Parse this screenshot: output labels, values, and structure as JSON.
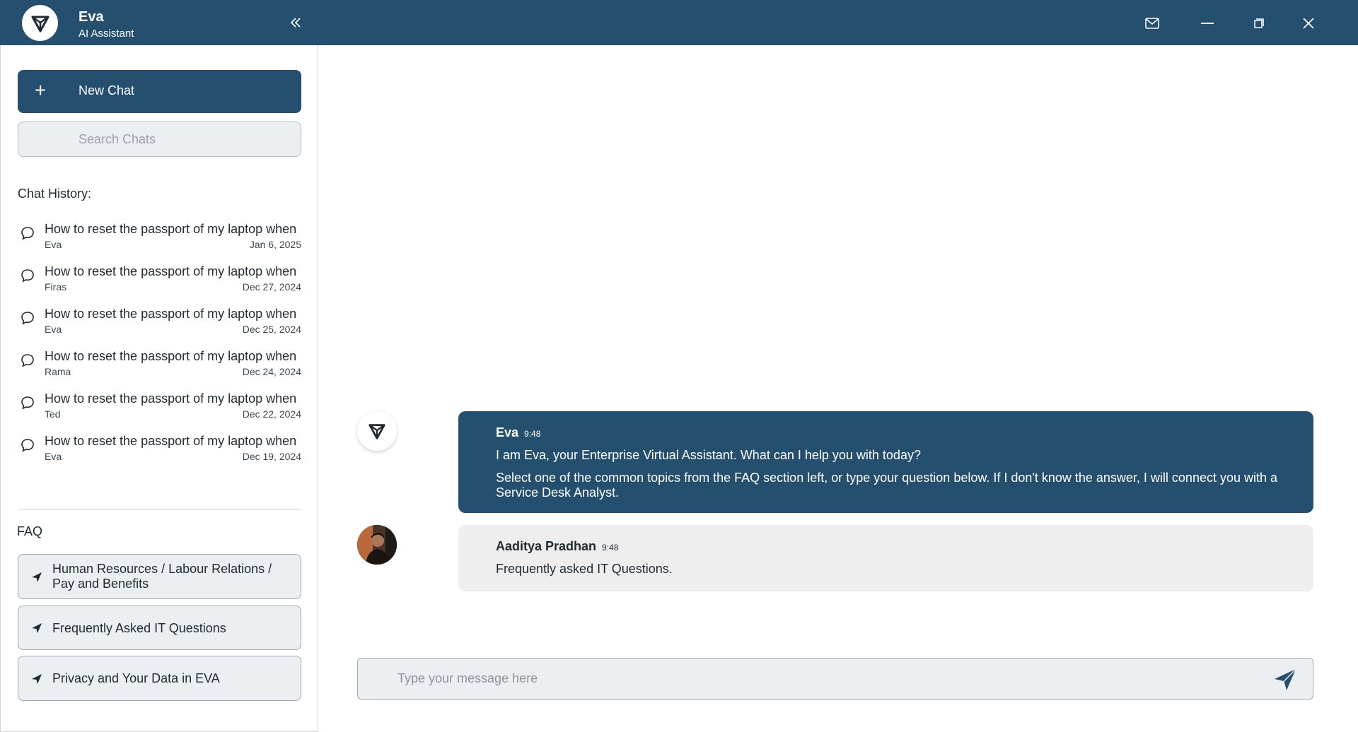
{
  "app": {
    "name": "Eva",
    "subtitle": "AI Assistant"
  },
  "sidebar": {
    "new_chat_label": "New Chat",
    "search_placeholder": "Search Chats",
    "history_title": "Chat History:",
    "history": [
      {
        "title": "How to reset the passport of my laptop when",
        "who": "Eva",
        "date": "Jan 6, 2025"
      },
      {
        "title": "How to reset the passport of my laptop when",
        "who": "Firas",
        "date": "Dec 27, 2024"
      },
      {
        "title": "How to reset the passport of my laptop when",
        "who": "Eva",
        "date": "Dec 25, 2024"
      },
      {
        "title": "How to reset the passport of my laptop when",
        "who": "Rama",
        "date": "Dec 24, 2024"
      },
      {
        "title": "How to reset the passport of my laptop when",
        "who": "Ted",
        "date": "Dec 22, 2024"
      },
      {
        "title": "How to reset the passport of my laptop when",
        "who": "Eva",
        "date": "Dec 19, 2024"
      }
    ],
    "faq_title": "FAQ",
    "faq": [
      {
        "label": "Human Resources / Labour Relations / Pay and Benefits"
      },
      {
        "label": "Frequently Asked IT Questions"
      },
      {
        "label": "Privacy and Your Data in EVA"
      }
    ]
  },
  "chat": {
    "messages": [
      {
        "name": "Eva",
        "time": "9:48",
        "line1": "I am Eva, your Enterprise Virtual Assistant. What can I help you with today?",
        "line2": "Select one of the common topics from the FAQ section left, or type your question below. If I don't know the answer, I will connect you with a Service Desk Analyst."
      },
      {
        "name": "Aaditya Pradhan",
        "time": "9:48",
        "line1": "Frequently asked IT Questions."
      }
    ],
    "composer_placeholder": "Type your message here"
  },
  "icons": {
    "logo": "eva-logo-icon",
    "collapse": "double-chevron-left-icon",
    "mail": "mail-icon",
    "minimize": "minimize-icon",
    "restore": "restore-icon",
    "close": "close-icon",
    "send": "send-icon",
    "chat": "chat-bubble-icon"
  },
  "colors": {
    "primary": "#244f6e",
    "panel": "#eceff1",
    "user_bubble": "#eeeeee"
  }
}
